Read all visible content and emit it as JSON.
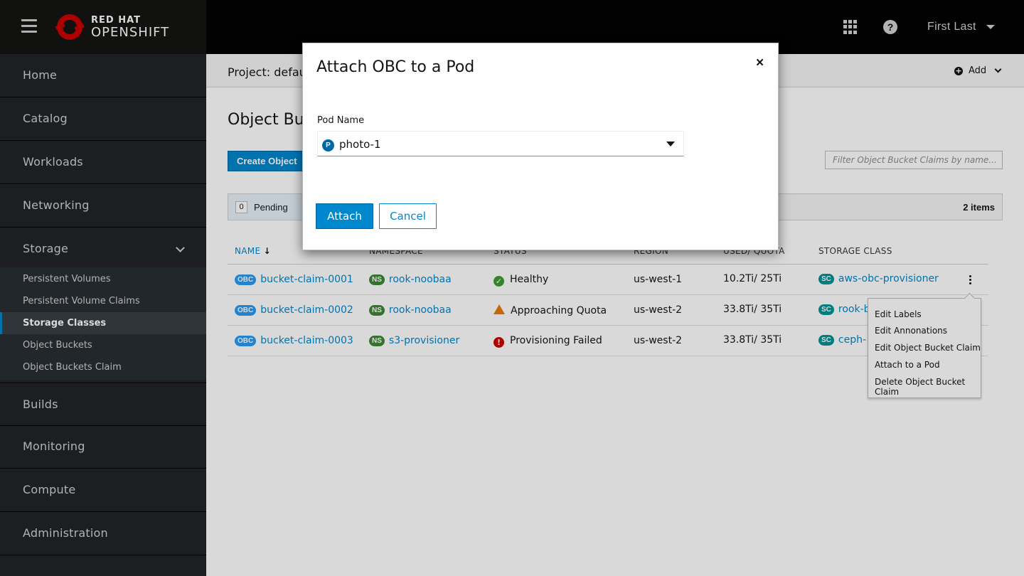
{
  "masthead": {
    "brand_line1": "RED HAT",
    "brand_line2": "OPENSHIFT",
    "help_icon_glyph": "?",
    "user_name": "First Last",
    "icons": [
      "hamburger-icon",
      "redhat-logo",
      "apps-grid-icon",
      "help-icon",
      "caret-down-icon"
    ]
  },
  "sidebar": {
    "items": [
      {
        "label": "Home"
      },
      {
        "label": "Catalog"
      },
      {
        "label": "Workloads"
      },
      {
        "label": "Networking"
      },
      {
        "label": "Storage",
        "expanded": true
      },
      {
        "label": "Builds"
      },
      {
        "label": "Monitoring"
      },
      {
        "label": "Compute"
      },
      {
        "label": "Administration"
      }
    ],
    "storage_subitems": [
      {
        "label": "Persistent Volumes"
      },
      {
        "label": "Persistent Volume Claims"
      },
      {
        "label": "Storage Classes",
        "active": true
      },
      {
        "label": "Object Buckets"
      },
      {
        "label": "Object Buckets Claim"
      }
    ]
  },
  "project_bar": {
    "label": "Project:  defau",
    "add_label": "Add",
    "add_icon_glyph": "+"
  },
  "page": {
    "title": "Object Buck",
    "create_button": "Create Object",
    "filter_placeholder": "Filter Object Bucket Claims by name...",
    "pending_count": "0",
    "pending_label": "Pending",
    "items_count": "2 items"
  },
  "table": {
    "columns": [
      "NAME",
      "NAMESPACE",
      "STATUS",
      "REGION",
      "USED/ QUOTA",
      "STORAGE CLASS"
    ],
    "sort_glyph": "↓",
    "rows": [
      {
        "name_badge": "OBC",
        "name": "bucket-claim-0001",
        "ns_badge": "NS",
        "namespace": "rook-noobaa",
        "status": "Healthy",
        "status_glyph": "✓",
        "status_kind": "ok",
        "region": "us-west-1",
        "usage": "10.2Ti/ 25Ti",
        "sc_badge": "SC",
        "storage_class": "aws-obc-provisioner"
      },
      {
        "name_badge": "OBC",
        "name": "bucket-claim-0002",
        "ns_badge": "NS",
        "namespace": "rook-noobaa",
        "status": "Approaching Quota",
        "status_kind": "warning",
        "region": "us-west-2",
        "usage": "33.8Ti/ 35Ti",
        "sc_badge": "SC",
        "storage_class": "rook-b"
      },
      {
        "name_badge": "OBC",
        "name": "bucket-claim-0003",
        "ns_badge": "NS",
        "namespace": "s3-provisioner",
        "status": "Provisioning Failed",
        "status_glyph": "!",
        "status_kind": "error",
        "region": "us-west-2",
        "usage": "33.8Ti/ 35Ti",
        "sc_badge": "SC",
        "storage_class": "ceph-"
      }
    ]
  },
  "kebab_menu": {
    "items": [
      "Edit Labels",
      "Edit Annonations",
      "Edit Object Bucket Claim",
      "Attach to a Pod",
      "Delete Object Bucket Claim"
    ]
  },
  "modal": {
    "title": "Attach OBC to a Pod",
    "close_glyph": "×",
    "field_label": "Pod Name",
    "pod_badge": "P",
    "selected_pod": "photo-1",
    "attach_button": "Attach",
    "cancel_button": "Cancel"
  },
  "colors": {
    "primary": "#0088ce",
    "masthead": "#030303",
    "sidebar": "#212427",
    "obc_badge": "#2b9af3",
    "ns_badge": "#3e8635",
    "sc_badge": "#009596",
    "pod_badge": "#0066a7",
    "ok": "#3f9c35",
    "warning": "#ec7a08",
    "error": "#cc0000"
  }
}
